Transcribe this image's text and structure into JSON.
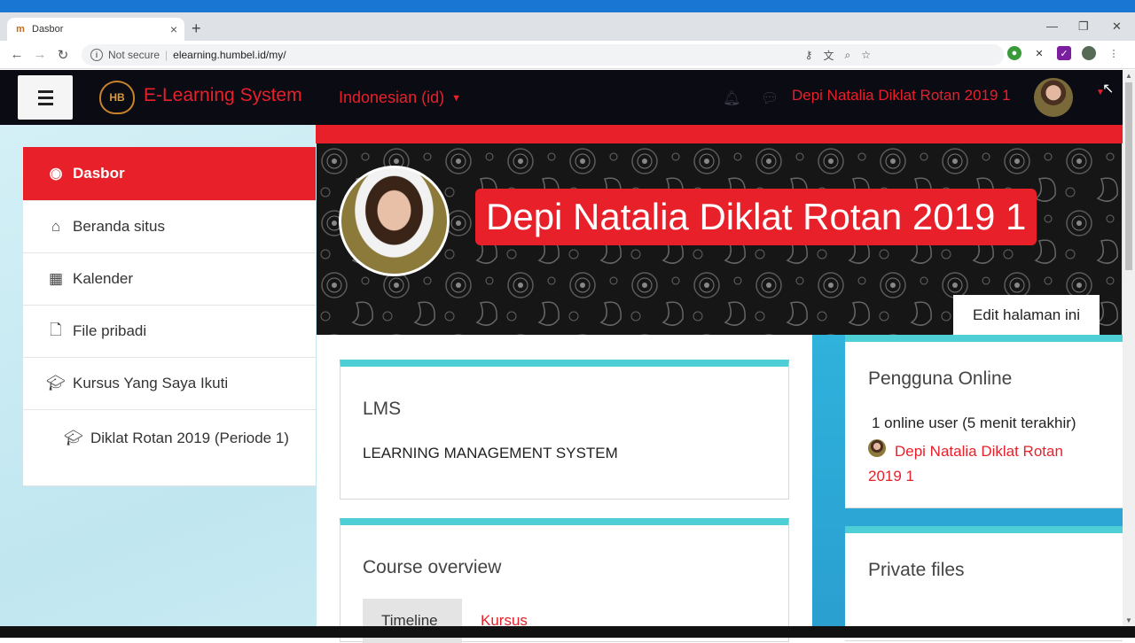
{
  "browser": {
    "tab_title": "Dasbor",
    "tab_favicon": "moodle-icon",
    "new_tab": "+",
    "security": "Not secure",
    "url": "elearning.humbel.id/my/"
  },
  "navbar": {
    "brand": "E-Learning System",
    "logo_text": "HB",
    "language": "Indonesian (id)",
    "user_name": "Depi Natalia Diklat Rotan 2019 1"
  },
  "sidebar": {
    "items": [
      {
        "label": "Dasbor",
        "icon": "dashboard-icon"
      },
      {
        "label": "Beranda situs",
        "icon": "home-icon"
      },
      {
        "label": "Kalender",
        "icon": "calendar-icon"
      },
      {
        "label": "File pribadi",
        "icon": "file-icon"
      },
      {
        "label": "Kursus Yang Saya Ikuti",
        "icon": "graduation-cap-icon"
      },
      {
        "label": "Diklat Rotan 2019 (Periode 1)",
        "icon": "graduation-cap-icon"
      }
    ]
  },
  "header": {
    "full_name": "Depi Natalia Diklat Rotan 2019 1",
    "edit_button": "Edit halaman ini"
  },
  "main": {
    "lms_card": {
      "title": "LMS",
      "text": "LEARNING MANAGEMENT SYSTEM"
    },
    "overview_card": {
      "title": "Course overview",
      "tabs": [
        "Timeline",
        "Kursus"
      ]
    }
  },
  "right": {
    "online": {
      "title": "Pengguna Online",
      "summary": "1 online user (5 menit terakhir)",
      "user": "Depi Natalia Diklat Rotan 2019 1"
    },
    "private_files": {
      "title": "Private files"
    }
  },
  "colors": {
    "accent": "#e8202a",
    "teal": "#4ecfd6",
    "navbar": "#0b0b14"
  }
}
